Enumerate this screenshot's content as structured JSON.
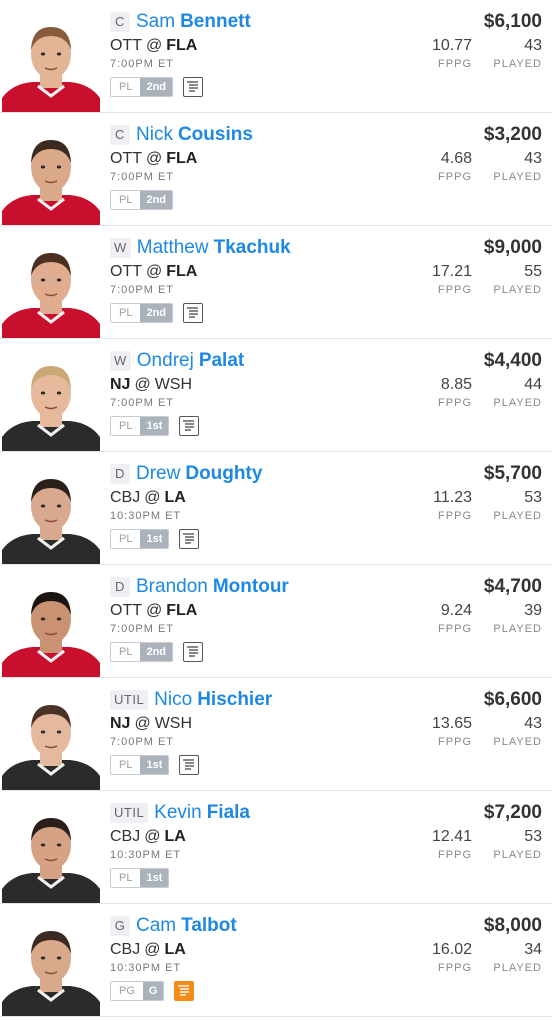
{
  "labels": {
    "fppg": "FPPG",
    "played": "PLAYED"
  },
  "players": [
    {
      "pos": "C",
      "first": "Sam",
      "last": "Bennett",
      "away": "OTT",
      "home": "FLA",
      "bold": "home",
      "time": "7:00PM ET",
      "salary": "$6,100",
      "fppg": "10.77",
      "played": "43",
      "badge_l": "PL",
      "badge_r": "2nd",
      "note": "normal",
      "jersey": "#c8102e",
      "skin": "#e2b596",
      "hair": "#8a5a3c"
    },
    {
      "pos": "C",
      "first": "Nick",
      "last": "Cousins",
      "away": "OTT",
      "home": "FLA",
      "bold": "home",
      "time": "7:00PM ET",
      "salary": "$3,200",
      "fppg": "4.68",
      "played": "43",
      "badge_l": "PL",
      "badge_r": "2nd",
      "note": "none",
      "jersey": "#c8102e",
      "skin": "#d9a98a",
      "hair": "#3b2a20"
    },
    {
      "pos": "W",
      "first": "Matthew",
      "last": "Tkachuk",
      "away": "OTT",
      "home": "FLA",
      "bold": "home",
      "time": "7:00PM ET",
      "salary": "$9,000",
      "fppg": "17.21",
      "played": "55",
      "badge_l": "PL",
      "badge_r": "2nd",
      "note": "normal",
      "jersey": "#c8102e",
      "skin": "#e0ad90",
      "hair": "#4a3020"
    },
    {
      "pos": "W",
      "first": "Ondrej",
      "last": "Palat",
      "away": "NJ",
      "home": "WSH",
      "bold": "away",
      "time": "7:00PM ET",
      "salary": "$4,400",
      "fppg": "8.85",
      "played": "44",
      "badge_l": "PL",
      "badge_r": "1st",
      "note": "normal",
      "jersey": "#2b2b2b",
      "skin": "#e6b89c",
      "hair": "#c9a873"
    },
    {
      "pos": "D",
      "first": "Drew",
      "last": "Doughty",
      "away": "CBJ",
      "home": "LA",
      "bold": "home",
      "time": "10:30PM ET",
      "salary": "$5,700",
      "fppg": "11.23",
      "played": "53",
      "badge_l": "PL",
      "badge_r": "1st",
      "note": "normal",
      "jersey": "#2b2b2b",
      "skin": "#d8a98e",
      "hair": "#2a1f1a"
    },
    {
      "pos": "D",
      "first": "Brandon",
      "last": "Montour",
      "away": "OTT",
      "home": "FLA",
      "bold": "home",
      "time": "7:00PM ET",
      "salary": "$4,700",
      "fppg": "9.24",
      "played": "39",
      "badge_l": "PL",
      "badge_r": "2nd",
      "note": "normal",
      "jersey": "#c8102e",
      "skin": "#c99273",
      "hair": "#1c1410"
    },
    {
      "pos": "UTIL",
      "first": "Nico",
      "last": "Hischier",
      "away": "NJ",
      "home": "WSH",
      "bold": "away",
      "time": "7:00PM ET",
      "salary": "$6,600",
      "fppg": "13.65",
      "played": "43",
      "badge_l": "PL",
      "badge_r": "1st",
      "note": "normal",
      "jersey": "#2b2b2b",
      "skin": "#e4b99e",
      "hair": "#4a3325"
    },
    {
      "pos": "UTIL",
      "first": "Kevin",
      "last": "Fiala",
      "away": "CBJ",
      "home": "LA",
      "bold": "home",
      "time": "10:30PM ET",
      "salary": "$7,200",
      "fppg": "12.41",
      "played": "53",
      "badge_l": "PL",
      "badge_r": "1st",
      "note": "none",
      "jersey": "#2b2b2b",
      "skin": "#d6a285",
      "hair": "#2a1f1a"
    },
    {
      "pos": "G",
      "first": "Cam",
      "last": "Talbot",
      "away": "CBJ",
      "home": "LA",
      "bold": "home",
      "time": "10:30PM ET",
      "salary": "$8,000",
      "fppg": "16.02",
      "played": "34",
      "badge_l": "PG",
      "badge_r": "G",
      "note": "hot",
      "jersey": "#2b2b2b",
      "skin": "#d9a98c",
      "hair": "#3a2a22"
    }
  ]
}
